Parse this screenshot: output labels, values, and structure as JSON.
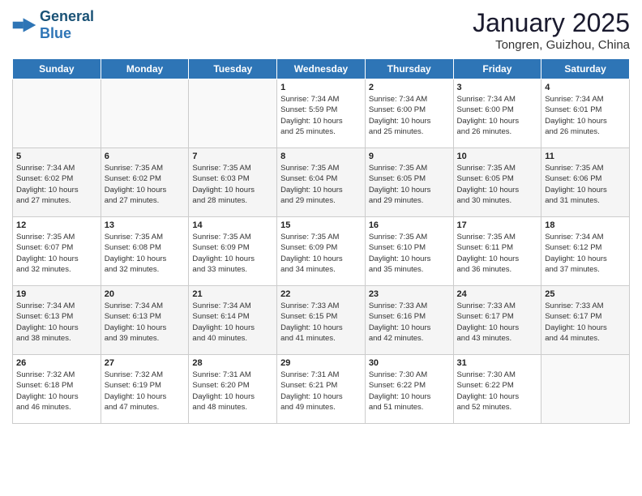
{
  "header": {
    "logo_general": "General",
    "logo_blue": "Blue",
    "month": "January 2025",
    "location": "Tongren, Guizhou, China"
  },
  "days_of_week": [
    "Sunday",
    "Monday",
    "Tuesday",
    "Wednesday",
    "Thursday",
    "Friday",
    "Saturday"
  ],
  "weeks": [
    [
      {
        "day": "",
        "info": ""
      },
      {
        "day": "",
        "info": ""
      },
      {
        "day": "",
        "info": ""
      },
      {
        "day": "1",
        "info": "Sunrise: 7:34 AM\nSunset: 5:59 PM\nDaylight: 10 hours\nand 25 minutes."
      },
      {
        "day": "2",
        "info": "Sunrise: 7:34 AM\nSunset: 6:00 PM\nDaylight: 10 hours\nand 25 minutes."
      },
      {
        "day": "3",
        "info": "Sunrise: 7:34 AM\nSunset: 6:00 PM\nDaylight: 10 hours\nand 26 minutes."
      },
      {
        "day": "4",
        "info": "Sunrise: 7:34 AM\nSunset: 6:01 PM\nDaylight: 10 hours\nand 26 minutes."
      }
    ],
    [
      {
        "day": "5",
        "info": "Sunrise: 7:34 AM\nSunset: 6:02 PM\nDaylight: 10 hours\nand 27 minutes."
      },
      {
        "day": "6",
        "info": "Sunrise: 7:35 AM\nSunset: 6:02 PM\nDaylight: 10 hours\nand 27 minutes."
      },
      {
        "day": "7",
        "info": "Sunrise: 7:35 AM\nSunset: 6:03 PM\nDaylight: 10 hours\nand 28 minutes."
      },
      {
        "day": "8",
        "info": "Sunrise: 7:35 AM\nSunset: 6:04 PM\nDaylight: 10 hours\nand 29 minutes."
      },
      {
        "day": "9",
        "info": "Sunrise: 7:35 AM\nSunset: 6:05 PM\nDaylight: 10 hours\nand 29 minutes."
      },
      {
        "day": "10",
        "info": "Sunrise: 7:35 AM\nSunset: 6:05 PM\nDaylight: 10 hours\nand 30 minutes."
      },
      {
        "day": "11",
        "info": "Sunrise: 7:35 AM\nSunset: 6:06 PM\nDaylight: 10 hours\nand 31 minutes."
      }
    ],
    [
      {
        "day": "12",
        "info": "Sunrise: 7:35 AM\nSunset: 6:07 PM\nDaylight: 10 hours\nand 32 minutes."
      },
      {
        "day": "13",
        "info": "Sunrise: 7:35 AM\nSunset: 6:08 PM\nDaylight: 10 hours\nand 32 minutes."
      },
      {
        "day": "14",
        "info": "Sunrise: 7:35 AM\nSunset: 6:09 PM\nDaylight: 10 hours\nand 33 minutes."
      },
      {
        "day": "15",
        "info": "Sunrise: 7:35 AM\nSunset: 6:09 PM\nDaylight: 10 hours\nand 34 minutes."
      },
      {
        "day": "16",
        "info": "Sunrise: 7:35 AM\nSunset: 6:10 PM\nDaylight: 10 hours\nand 35 minutes."
      },
      {
        "day": "17",
        "info": "Sunrise: 7:35 AM\nSunset: 6:11 PM\nDaylight: 10 hours\nand 36 minutes."
      },
      {
        "day": "18",
        "info": "Sunrise: 7:34 AM\nSunset: 6:12 PM\nDaylight: 10 hours\nand 37 minutes."
      }
    ],
    [
      {
        "day": "19",
        "info": "Sunrise: 7:34 AM\nSunset: 6:13 PM\nDaylight: 10 hours\nand 38 minutes."
      },
      {
        "day": "20",
        "info": "Sunrise: 7:34 AM\nSunset: 6:13 PM\nDaylight: 10 hours\nand 39 minutes."
      },
      {
        "day": "21",
        "info": "Sunrise: 7:34 AM\nSunset: 6:14 PM\nDaylight: 10 hours\nand 40 minutes."
      },
      {
        "day": "22",
        "info": "Sunrise: 7:33 AM\nSunset: 6:15 PM\nDaylight: 10 hours\nand 41 minutes."
      },
      {
        "day": "23",
        "info": "Sunrise: 7:33 AM\nSunset: 6:16 PM\nDaylight: 10 hours\nand 42 minutes."
      },
      {
        "day": "24",
        "info": "Sunrise: 7:33 AM\nSunset: 6:17 PM\nDaylight: 10 hours\nand 43 minutes."
      },
      {
        "day": "25",
        "info": "Sunrise: 7:33 AM\nSunset: 6:17 PM\nDaylight: 10 hours\nand 44 minutes."
      }
    ],
    [
      {
        "day": "26",
        "info": "Sunrise: 7:32 AM\nSunset: 6:18 PM\nDaylight: 10 hours\nand 46 minutes."
      },
      {
        "day": "27",
        "info": "Sunrise: 7:32 AM\nSunset: 6:19 PM\nDaylight: 10 hours\nand 47 minutes."
      },
      {
        "day": "28",
        "info": "Sunrise: 7:31 AM\nSunset: 6:20 PM\nDaylight: 10 hours\nand 48 minutes."
      },
      {
        "day": "29",
        "info": "Sunrise: 7:31 AM\nSunset: 6:21 PM\nDaylight: 10 hours\nand 49 minutes."
      },
      {
        "day": "30",
        "info": "Sunrise: 7:30 AM\nSunset: 6:22 PM\nDaylight: 10 hours\nand 51 minutes."
      },
      {
        "day": "31",
        "info": "Sunrise: 7:30 AM\nSunset: 6:22 PM\nDaylight: 10 hours\nand 52 minutes."
      },
      {
        "day": "",
        "info": ""
      }
    ]
  ]
}
